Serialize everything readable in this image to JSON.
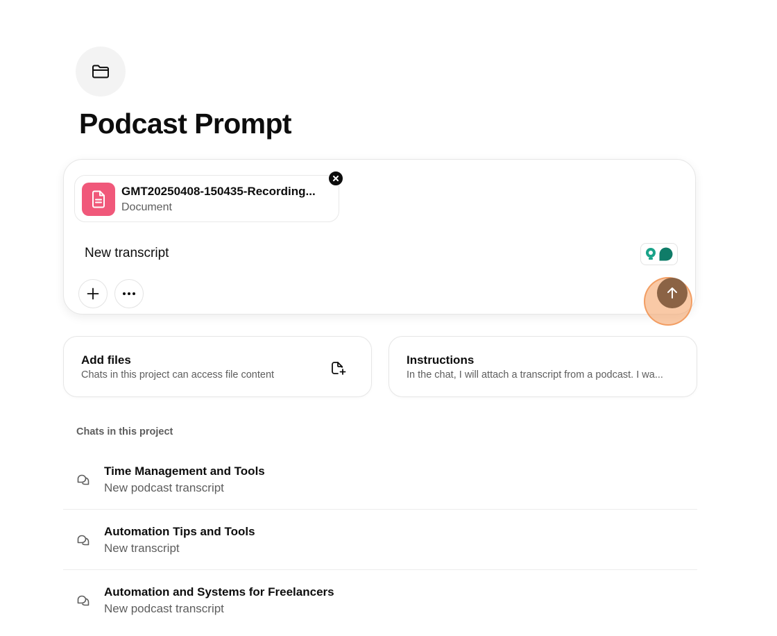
{
  "project": {
    "title": "Podcast Prompt",
    "icon": "folder-icon"
  },
  "composer": {
    "attachment": {
      "name": "GMT20250408-150435-Recording...",
      "type": "Document",
      "icon": "document-icon",
      "icon_color": "#f0587a"
    },
    "input_value": "New transcript",
    "add_icon": "plus-icon",
    "more_icon": "ellipsis-icon",
    "send_icon": "arrow-up-icon",
    "send_color": "#8b6345"
  },
  "cards": [
    {
      "title": "Add files",
      "subtitle": "Chats in this project can access file content",
      "icon": "add-file-icon"
    },
    {
      "title": "Instructions",
      "subtitle": "In the chat, I will attach a transcript from a podcast. I wa..."
    }
  ],
  "chats_section": {
    "label": "Chats in this project",
    "items": [
      {
        "title": "Time Management and Tools",
        "subtitle": "New podcast transcript",
        "icon": "chat-bubbles-icon"
      },
      {
        "title": "Automation Tips and Tools",
        "subtitle": "New transcript",
        "icon": "chat-bubbles-icon"
      },
      {
        "title": "Automation and Systems for Freelancers",
        "subtitle": "New podcast transcript",
        "icon": "chat-bubbles-icon"
      }
    ]
  }
}
